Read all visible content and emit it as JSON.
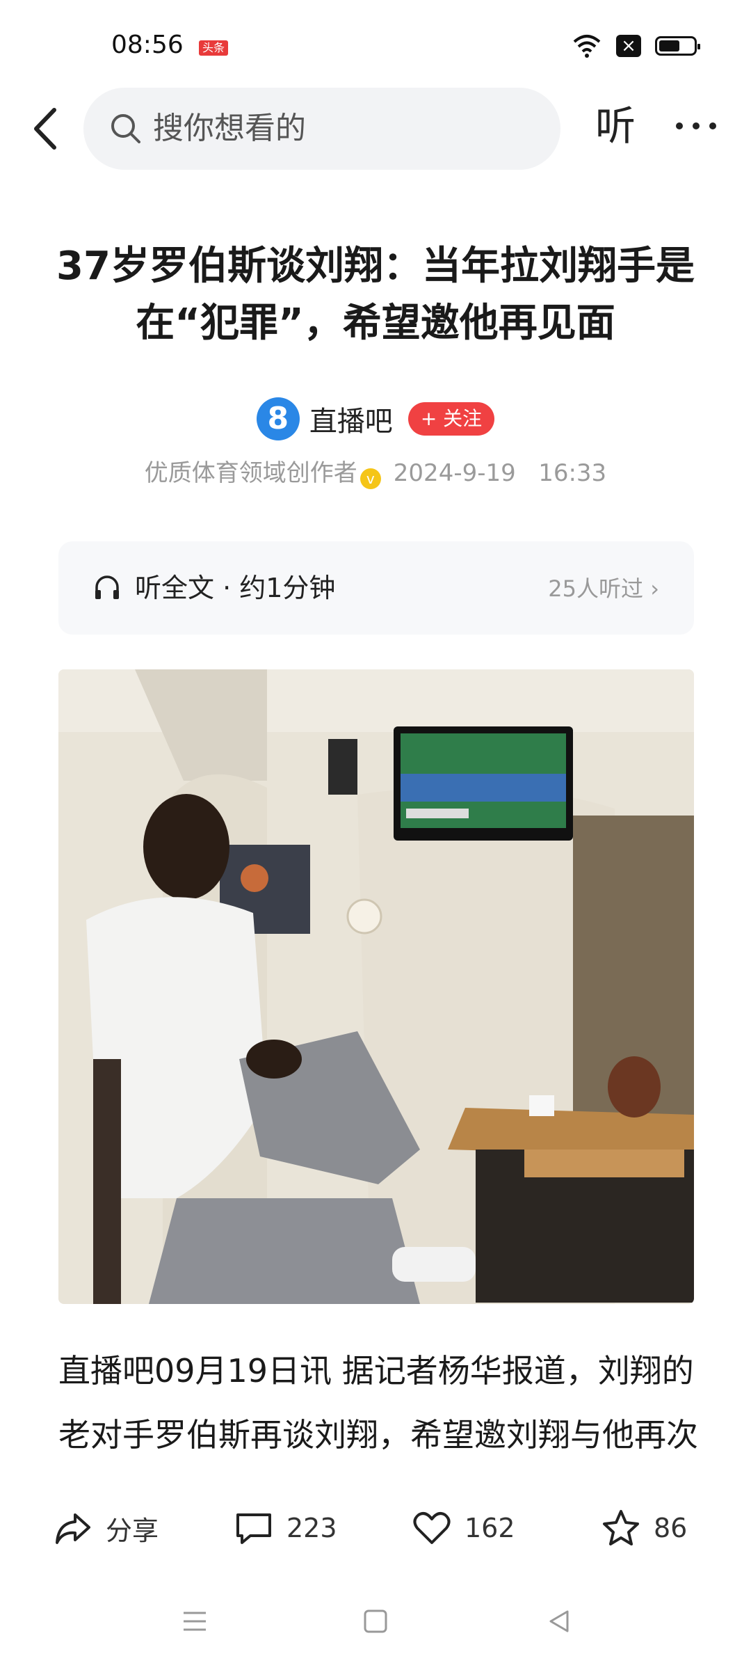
{
  "status_bar": {
    "time": "08:56",
    "app_badge": "头条",
    "battery_percent": 60
  },
  "top_nav": {
    "search_placeholder": "搜你想看的",
    "listen_label": "听"
  },
  "article": {
    "headline": "37岁罗伯斯谈刘翔：当年拉刘翔手是在“犯罪”，希望邀他再见面",
    "author_avatar_text": "8",
    "author_name": "直播吧",
    "follow_label": "+ 关注",
    "author_title": "优质体育领域创作者",
    "date": "2024-9-19",
    "time": "16:33",
    "listen_label": "听全文 · 约1分钟",
    "listen_count": "25人听过 ›",
    "body": "直播吧09月19日讯 据记者杨华报道，刘翔的老对手罗伯斯再谈刘翔，希望邀刘翔与他再次"
  },
  "actions": {
    "share_label": "分享",
    "comments": "223",
    "likes": "162",
    "favorites": "86"
  },
  "icons": [
    "back-icon",
    "search-icon",
    "more-icon",
    "headphone-icon",
    "share-icon",
    "comment-icon",
    "heart-icon",
    "star-icon",
    "menu-icon",
    "home-icon",
    "back-triangle-icon"
  ],
  "colors": {
    "follow": "#f04142",
    "avatar": "#2a87e6",
    "verify": "#f5c518"
  }
}
